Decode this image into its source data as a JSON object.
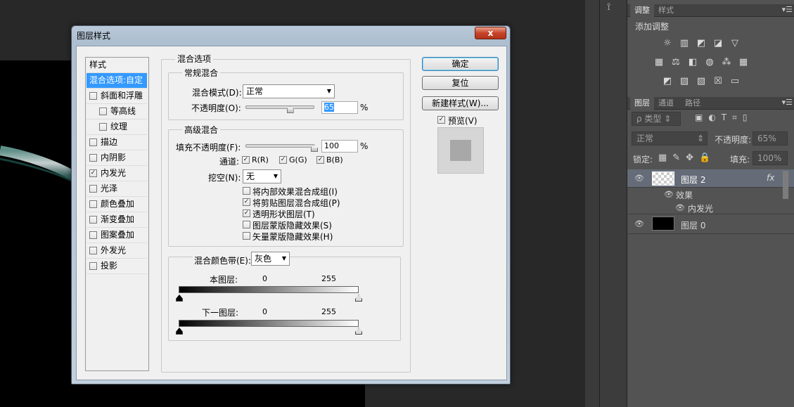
{
  "dialog": {
    "title": "图层样式",
    "close_label": "x",
    "list_header": "样式",
    "list_items": [
      {
        "label": "混合选项:自定",
        "checkbox": false,
        "checked": false,
        "selected": true
      },
      {
        "label": "斜面和浮雕",
        "checkbox": true,
        "checked": false
      },
      {
        "label": "等高线",
        "checkbox": true,
        "checked": false,
        "indent": true
      },
      {
        "label": "纹理",
        "checkbox": true,
        "checked": false,
        "indent": true
      },
      {
        "label": "描边",
        "checkbox": true,
        "checked": false
      },
      {
        "label": "内阴影",
        "checkbox": true,
        "checked": false
      },
      {
        "label": "内发光",
        "checkbox": true,
        "checked": true
      },
      {
        "label": "光泽",
        "checkbox": true,
        "checked": false
      },
      {
        "label": "颜色叠加",
        "checkbox": true,
        "checked": false
      },
      {
        "label": "渐变叠加",
        "checkbox": true,
        "checked": false
      },
      {
        "label": "图案叠加",
        "checkbox": true,
        "checked": false
      },
      {
        "label": "外发光",
        "checkbox": true,
        "checked": false
      },
      {
        "label": "投影",
        "checkbox": true,
        "checked": false
      }
    ],
    "blend_options": {
      "title": "混合选项",
      "general": {
        "title": "常规混合",
        "mode_label": "混合模式(D):",
        "mode_value": "正常",
        "opacity_label": "不透明度(O):",
        "opacity_value": "65",
        "opacity_unit": "%",
        "opacity_fraction": 0.65
      },
      "advanced": {
        "title": "高级混合",
        "fill_label": "填充不透明度(F):",
        "fill_value": "100",
        "fill_unit": "%",
        "fill_fraction": 1.0,
        "channels_label": "通道:",
        "channels": [
          {
            "label": "R(R)",
            "checked": true
          },
          {
            "label": "G(G)",
            "checked": true
          },
          {
            "label": "B(B)",
            "checked": true
          }
        ],
        "knockout_label": "挖空(N):",
        "knockout_value": "无",
        "options": [
          {
            "label": "将内部效果混合成组(I)",
            "checked": false
          },
          {
            "label": "将剪贴图层混合成组(P)",
            "checked": true
          },
          {
            "label": "透明形状图层(T)",
            "checked": true
          },
          {
            "label": "图层蒙版隐藏效果(S)",
            "checked": false
          },
          {
            "label": "矢量蒙版隐藏效果(H)",
            "checked": false
          }
        ]
      },
      "blend_if": {
        "label": "混合颜色带(E):",
        "value": "灰色",
        "this_layer_label": "本图层:",
        "underlying_label": "下一图层:",
        "low": "0",
        "high": "255"
      }
    },
    "buttons": {
      "ok": "确定",
      "reset": "复位",
      "new_style": "新建样式(W)...",
      "preview": "预览(V)",
      "preview_checked": true
    }
  },
  "adjustments_panel": {
    "tabs": [
      "调整",
      "样式"
    ],
    "title": "添加调整",
    "icons": [
      "brightness-icon",
      "levels-icon",
      "curves-icon",
      "exposure-icon",
      "vibrance-icon",
      "hue-saturation-icon",
      "color-balance-icon",
      "black-white-icon",
      "photo-filter-icon",
      "channel-mixer-icon",
      "color-lookup-icon",
      "invert-icon",
      "posterize-icon",
      "threshold-icon",
      "selective-color-icon",
      "gradient-map-icon"
    ]
  },
  "layers_panel": {
    "tabs": [
      "图层",
      "通道",
      "路径"
    ],
    "filter_label": "ρ 类型",
    "blend_mode": "正常",
    "opacity_label": "不透明度:",
    "opacity_value": "65%",
    "lock_label": "锁定:",
    "fill_label": "填充:",
    "fill_value": "100%",
    "layers": [
      {
        "name": "图层 2",
        "selected": true,
        "fx": "fx"
      },
      {
        "name": "效果"
      },
      {
        "name": "内发光"
      },
      {
        "name": "图层 0"
      }
    ]
  }
}
